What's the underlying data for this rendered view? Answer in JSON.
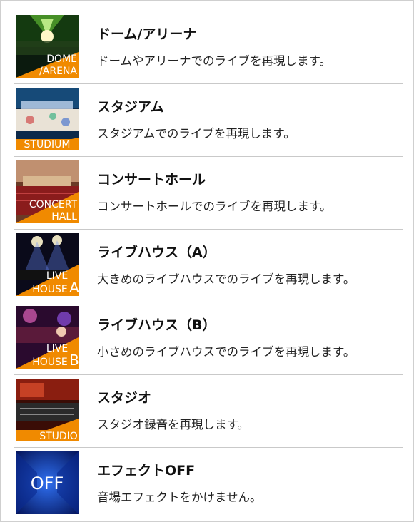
{
  "colors": {
    "accent": "#f08a00",
    "divider": "#c9c9c9"
  },
  "items": [
    {
      "title": "ドーム/アリーナ",
      "desc": "ドームやアリーナでのライブを再現します。",
      "thumb_text": [
        "DOME",
        "/ARENA"
      ]
    },
    {
      "title": "スタジアム",
      "desc": "スタジアムでのライブを再現します。",
      "thumb_text": [
        "STUDIUM"
      ]
    },
    {
      "title": "コンサートホール",
      "desc": "コンサートホールでのライブを再現します。",
      "thumb_text": [
        "CONCERT",
        "HALL"
      ]
    },
    {
      "title": "ライブハウス（A）",
      "desc": "大きめのライブハウスでのライブを再現します。",
      "thumb_text": [
        "LIVE",
        "HOUSE",
        "A"
      ]
    },
    {
      "title": "ライブハウス（B）",
      "desc": "小さめのライブハウスでのライブを再現します。",
      "thumb_text": [
        "LIVE",
        "HOUSE",
        "B"
      ]
    },
    {
      "title": "スタジオ",
      "desc": "スタジオ録音を再現します。",
      "thumb_text": [
        "STUDIO"
      ]
    },
    {
      "title": "エフェクトOFF",
      "desc": "音場エフェクトをかけません。",
      "thumb_text": [
        "OFF"
      ]
    }
  ]
}
